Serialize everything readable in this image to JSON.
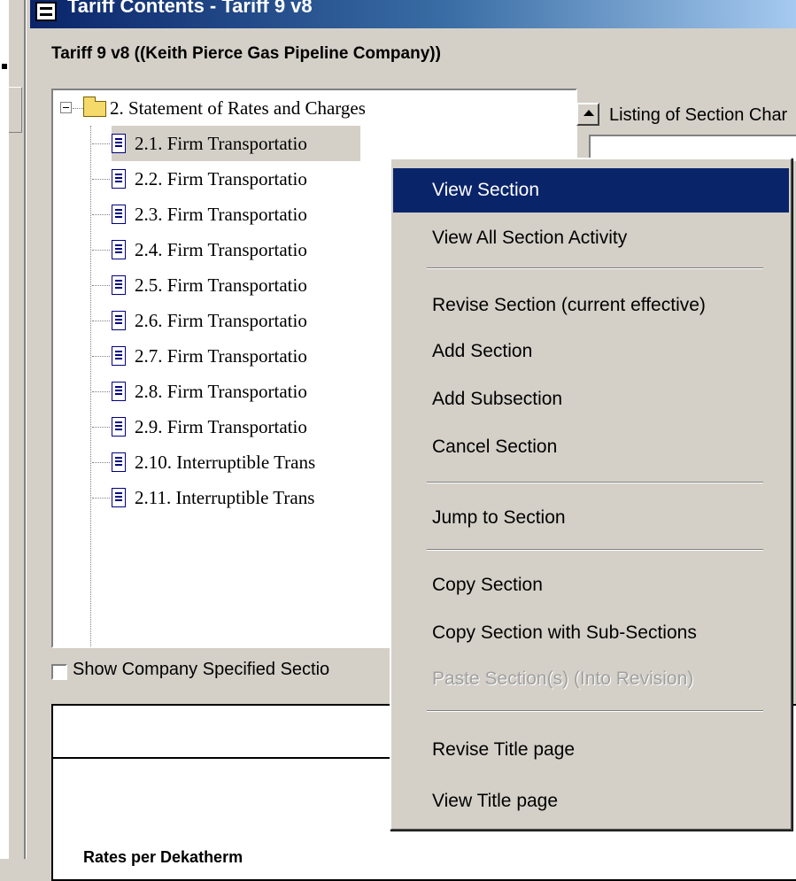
{
  "window": {
    "title": "Tariff Contents - Tariff 9 v8"
  },
  "heading": "Tariff 9 v8 ((Keith Pierce Gas Pipeline Company))",
  "tree": {
    "parent_label": "2. Statement of Rates and Charges",
    "items": [
      {
        "label": "2.1. Firm Transportatio"
      },
      {
        "label": "2.2. Firm Transportatio"
      },
      {
        "label": "2.3. Firm Transportatio"
      },
      {
        "label": "2.4. Firm Transportatio"
      },
      {
        "label": "2.5. Firm Transportatio"
      },
      {
        "label": "2.6. Firm Transportatio"
      },
      {
        "label": "2.7. Firm Transportatio"
      },
      {
        "label": "2.8. Firm Transportatio"
      },
      {
        "label": "2.9. Firm Transportatio"
      },
      {
        "label": "2.10. Interruptible Trans"
      },
      {
        "label": "2.11. Interruptible Trans"
      }
    ]
  },
  "listing_label": "Listing of Section Char",
  "checkbox_label": "Show Company Specified Sectio",
  "rates_label": "Rates per Dekatherm",
  "context_menu": {
    "items": [
      {
        "label": "View Section",
        "selected": true
      },
      {
        "label": "View All Section Activity"
      },
      {
        "label": "Revise Section (current effective)"
      },
      {
        "label": "Add Section"
      },
      {
        "label": "Add Subsection"
      },
      {
        "label": "Cancel Section"
      },
      {
        "label": "Jump to Section"
      },
      {
        "label": "Copy Section"
      },
      {
        "label": "Copy Section with Sub-Sections"
      },
      {
        "label": "Paste Section(s) (Into Revision)",
        "disabled": true
      },
      {
        "label": "Revise Title page"
      },
      {
        "label": "View Title page"
      }
    ]
  },
  "colors": {
    "titlebar_start": "#0a246a",
    "titlebar_end": "#a6caf0",
    "menu_highlight": "#0a246a",
    "window_face": "#d4d0c8"
  }
}
